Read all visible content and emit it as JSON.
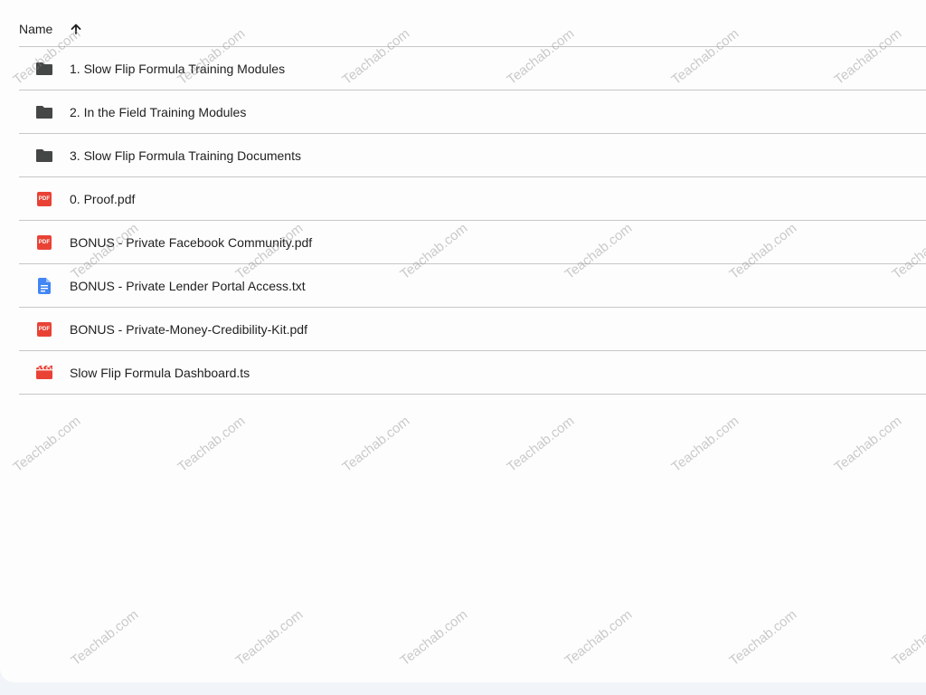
{
  "header": {
    "name_label": "Name"
  },
  "files": [
    {
      "name": "1. Slow Flip Formula Training Modules",
      "type": "folder",
      "icon": "folder-icon"
    },
    {
      "name": "2. In the Field Training Modules",
      "type": "folder",
      "icon": "folder-icon"
    },
    {
      "name": "3. Slow Flip Formula Training Documents",
      "type": "folder",
      "icon": "folder-icon"
    },
    {
      "name": "0. Proof.pdf",
      "type": "pdf",
      "icon": "pdf-icon"
    },
    {
      "name": "BONUS - Private Facebook Community.pdf",
      "type": "pdf",
      "icon": "pdf-icon"
    },
    {
      "name": "BONUS - Private Lender Portal Access.txt",
      "type": "txt",
      "icon": "document-icon"
    },
    {
      "name": "BONUS - Private-Money-Credibility-Kit.pdf",
      "type": "pdf",
      "icon": "pdf-icon"
    },
    {
      "name": "Slow Flip Formula Dashboard.ts",
      "type": "video",
      "icon": "video-icon"
    }
  ],
  "icon_labels": {
    "pdf": "PDF"
  },
  "watermark_text": "Teachab.com",
  "colors": {
    "folder": "#444746",
    "pdf": "#e94235",
    "doc": "#4285f4",
    "video": "#e94235",
    "divider": "#c7c7c7"
  }
}
